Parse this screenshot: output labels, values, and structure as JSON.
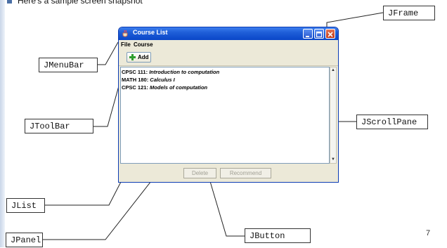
{
  "slide": {
    "intro_text": "Here's a sample screen snapshot",
    "page_number": "7"
  },
  "window": {
    "title": "Course List",
    "menus": [
      "File",
      "Course"
    ],
    "toolbar": {
      "add_label": "Add"
    },
    "courses": [
      {
        "code": "CPSC 111:",
        "name": "Introduction to computation"
      },
      {
        "code": "MATH 180:",
        "name": "Calculus I"
      },
      {
        "code": "CPSC 121:",
        "name": "Models of computation"
      }
    ],
    "buttons": {
      "delete": "Delete",
      "recommend": "Recommend"
    }
  },
  "callouts": {
    "jframe": "JFrame",
    "jmenubar": "JMenuBar",
    "jscrollpane": "JScrollPane",
    "jtoolbar": "JToolBar",
    "jlist": "JList",
    "jpanel": "JPanel",
    "jbutton": "JButton"
  },
  "colors": {
    "titlebar": "#0a46c8",
    "close_button": "#c0391a",
    "window_bg": "#ece9d8",
    "add_icon": "#2e9e2e"
  },
  "icons": [
    "java-cup-icon",
    "minimize-icon",
    "maximize-icon",
    "close-icon",
    "plus-icon",
    "scroll-up-icon",
    "scroll-down-icon"
  ]
}
